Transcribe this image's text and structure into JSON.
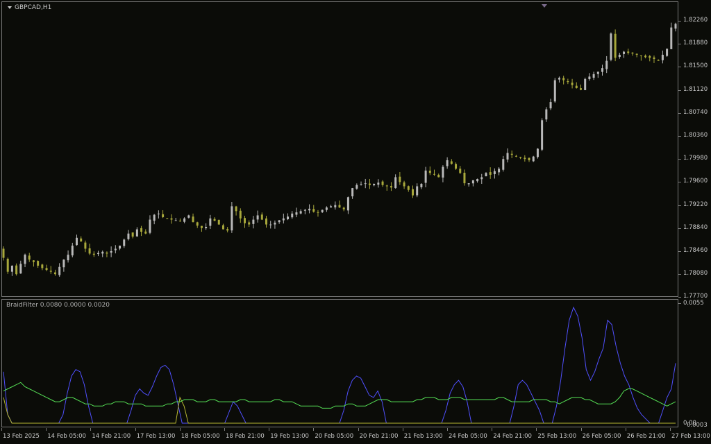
{
  "chart": {
    "title": "GBPCAD,H1",
    "indicator_title": "BraidFilter 0.0080 0.0000 0.0020",
    "colors": {
      "background": "#0b0c08",
      "bull": "#b9b9b9",
      "bear": "#a8a83c",
      "line_blue": "#5050ff",
      "line_yellow": "#b8b832",
      "line_green": "#56e256"
    }
  },
  "price_axis": {
    "labels": [
      "1.82260",
      "1.81880",
      "1.81500",
      "1.81120",
      "1.80740",
      "1.80360",
      "1.79980",
      "1.79600",
      "1.79220",
      "1.78840",
      "1.78460",
      "1.78080",
      "1.77700"
    ]
  },
  "indicator_axis": {
    "top_label": "0.0055",
    "bottom_labels": [
      "0.00",
      "0.0003"
    ]
  },
  "time_axis": {
    "labels": [
      "13 Feb 2025",
      "14 Feb 05:00",
      "14 Feb 21:00",
      "17 Feb 13:00",
      "18 Feb 05:00",
      "18 Feb 21:00",
      "19 Feb 13:00",
      "20 Feb 05:00",
      "20 Feb 21:00",
      "21 Feb 13:00",
      "24 Feb 05:00",
      "24 Feb 21:00",
      "25 Feb 13:00",
      "26 Feb 05:00",
      "26 Feb 21:00",
      "27 Feb 13:00"
    ]
  },
  "chart_data": {
    "type": "candlestick",
    "symbol": "GBPCAD",
    "timeframe": "H1",
    "ylim": [
      1.777,
      1.8245
    ],
    "closes": [
      1.7835,
      1.7812,
      1.7822,
      1.7808,
      1.7825,
      1.784,
      1.7832,
      1.7828,
      1.7822,
      1.7818,
      1.7815,
      1.7812,
      1.7808,
      1.782,
      1.7832,
      1.784,
      1.7855,
      1.7868,
      1.7862,
      1.785,
      1.7842,
      1.784,
      1.7843,
      1.7845,
      1.7842,
      1.7846,
      1.785,
      1.7855,
      1.7865,
      1.7875,
      1.787,
      1.7882,
      1.7878,
      1.7875,
      1.7898,
      1.7906,
      1.7908,
      1.7902,
      1.79,
      1.7898,
      1.7897,
      1.7895,
      1.79,
      1.7905,
      1.7894,
      1.7888,
      1.7884,
      1.7886,
      1.79,
      1.7896,
      1.789,
      1.7882,
      1.788,
      1.792,
      1.7912,
      1.79,
      1.7892,
      1.789,
      1.7898,
      1.7905,
      1.7898,
      1.789,
      1.789,
      1.7893,
      1.7897,
      1.79,
      1.7903,
      1.7908,
      1.791,
      1.7912,
      1.7914,
      1.7916,
      1.7911,
      1.791,
      1.7914,
      1.7918,
      1.792,
      1.7922,
      1.7918,
      1.7915,
      1.7935,
      1.795,
      1.7955,
      1.7957,
      1.7958,
      1.7955,
      1.7957,
      1.7959,
      1.7955,
      1.7953,
      1.7951,
      1.7968,
      1.796,
      1.7953,
      1.7947,
      1.7938,
      1.7953,
      1.7957,
      1.7979,
      1.7975,
      1.7973,
      1.7968,
      1.7985,
      1.7996,
      1.799,
      1.7982,
      1.7975,
      1.7958,
      1.7958,
      1.7963,
      1.7965,
      1.7968,
      1.7975,
      1.7972,
      1.7978,
      1.7982,
      1.7998,
      1.8008,
      1.8005,
      1.8002,
      1.8,
      1.7998,
      1.7996,
      1.8002,
      1.8015,
      1.8062,
      1.808,
      1.8092,
      1.8128,
      1.8132,
      1.8128,
      1.8125,
      1.812,
      1.8115,
      1.8112,
      1.813,
      1.8134,
      1.8138,
      1.8142,
      1.8148,
      1.816,
      1.8205,
      1.8165,
      1.817,
      1.8175,
      1.8173,
      1.8172,
      1.817,
      1.8168,
      1.8166,
      1.8165,
      1.8163,
      1.816,
      1.817,
      1.818,
      1.8215,
      1.8221
    ]
  },
  "indicator_data": {
    "type": "line",
    "ylim": [
      0,
      0.0055
    ],
    "series": [
      {
        "color": "#5050ff",
        "values": [
          0.0024,
          0.0004,
          0.0,
          0.0,
          0.0,
          0.0,
          0.0,
          0.0,
          0.0,
          0.0,
          0.0,
          0.0,
          0.0,
          0.0,
          0.0004,
          0.0014,
          0.0022,
          0.0025,
          0.0024,
          0.0018,
          0.0008,
          0.0,
          0.0,
          0.0,
          0.0,
          0.0,
          0.0,
          0.0,
          0.0,
          0.0,
          0.0006,
          0.0013,
          0.0016,
          0.0014,
          0.0013,
          0.0017,
          0.0022,
          0.0026,
          0.0027,
          0.0025,
          0.0018,
          0.0009,
          0.0,
          0.0,
          0.0,
          0.0,
          0.0,
          0.0,
          0.0,
          0.0,
          0.0,
          0.0,
          0.0,
          0.0005,
          0.001,
          0.0008,
          0.0004,
          0.0,
          0.0,
          0.0,
          0.0,
          0.0,
          0.0,
          0.0,
          0.0,
          0.0,
          0.0,
          0.0,
          0.0,
          0.0,
          0.0,
          0.0,
          0.0,
          0.0,
          0.0,
          0.0,
          0.0,
          0.0,
          0.0,
          0.0,
          0.0006,
          0.0015,
          0.002,
          0.0022,
          0.0021,
          0.0017,
          0.0013,
          0.0012,
          0.0015,
          0.001,
          0.0,
          0.0,
          0.0,
          0.0,
          0.0,
          0.0,
          0.0,
          0.0,
          0.0,
          0.0,
          0.0,
          0.0,
          0.0,
          0.0,
          0.0006,
          0.0014,
          0.0018,
          0.002,
          0.0017,
          0.001,
          0.0,
          0.0,
          0.0,
          0.0,
          0.0,
          0.0,
          0.0,
          0.0,
          0.0,
          0.0,
          0.0008,
          0.0018,
          0.002,
          0.0018,
          0.0014,
          0.001,
          0.0006,
          0.0,
          0.0,
          0.0,
          0.0008,
          0.002,
          0.0035,
          0.0048,
          0.0054,
          0.005,
          0.004,
          0.0025,
          0.002,
          0.0024,
          0.003,
          0.0035,
          0.0048,
          0.0046,
          0.0036,
          0.0028,
          0.0022,
          0.0018,
          0.0012,
          0.0007,
          0.0004,
          0.0002,
          0.0,
          0.0,
          0.0,
          0.0006,
          0.0012,
          0.0016,
          0.0028
        ]
      },
      {
        "color": "#b8b832",
        "values": [
          0.0012,
          0.0004,
          0.0,
          0.0,
          0.0,
          0.0,
          0.0,
          0.0,
          0.0,
          0.0,
          0.0,
          0.0,
          0.0,
          0.0,
          0.0,
          0.0,
          0.0,
          0.0,
          0.0,
          0.0,
          0.0,
          0.0,
          0.0,
          0.0,
          0.0,
          0.0,
          0.0,
          0.0,
          0.0,
          0.0,
          0.0,
          0.0,
          0.0,
          0.0,
          0.0,
          0.0,
          0.0,
          0.0,
          0.0,
          0.0,
          0.0,
          0.0,
          0.0012,
          0.0008,
          0.0,
          0.0,
          0.0,
          0.0,
          0.0,
          0.0,
          0.0,
          0.0,
          0.0,
          0.0,
          0.0,
          0.0,
          0.0,
          0.0,
          0.0,
          0.0,
          0.0,
          0.0,
          0.0,
          0.0,
          0.0,
          0.0,
          0.0,
          0.0,
          0.0,
          0.0,
          0.0,
          0.0,
          0.0,
          0.0,
          0.0,
          0.0,
          0.0,
          0.0,
          0.0,
          0.0,
          0.0,
          0.0,
          0.0,
          0.0,
          0.0,
          0.0,
          0.0,
          0.0,
          0.0,
          0.0,
          0.0,
          0.0,
          0.0,
          0.0,
          0.0,
          0.0,
          0.0,
          0.0,
          0.0,
          0.0,
          0.0,
          0.0,
          0.0,
          0.0,
          0.0,
          0.0,
          0.0,
          0.0,
          0.0,
          0.0,
          0.0,
          0.0,
          0.0,
          0.0,
          0.0,
          0.0,
          0.0,
          0.0,
          0.0,
          0.0,
          0.0,
          0.0,
          0.0,
          0.0,
          0.0,
          0.0,
          0.0,
          0.0,
          0.0,
          0.0,
          0.0,
          0.0,
          0.0,
          0.0,
          0.0,
          0.0,
          0.0,
          0.0,
          0.0,
          0.0,
          0.0,
          0.0,
          0.0,
          0.0,
          0.0,
          0.0,
          0.0,
          0.0,
          0.0,
          0.0,
          0.0,
          0.0,
          0.0,
          0.0,
          0.0,
          0.0,
          0.0,
          0.0,
          0.0,
          0.0,
          0.0
        ]
      },
      {
        "color": "#56e256",
        "values": [
          0.0015,
          0.0016,
          0.0017,
          0.0018,
          0.0019,
          0.0017,
          0.0016,
          0.0015,
          0.0014,
          0.0013,
          0.0012,
          0.0011,
          0.001,
          0.001,
          0.0011,
          0.0012,
          0.0012,
          0.0011,
          0.001,
          0.0009,
          0.0009,
          0.0008,
          0.0008,
          0.0008,
          0.0009,
          0.0009,
          0.001,
          0.001,
          0.001,
          0.0009,
          0.0009,
          0.0009,
          0.0009,
          0.0008,
          0.0008,
          0.0008,
          0.0008,
          0.0008,
          0.0009,
          0.0009,
          0.001,
          0.001,
          0.0011,
          0.0011,
          0.0011,
          0.001,
          0.001,
          0.001,
          0.0011,
          0.0011,
          0.001,
          0.001,
          0.001,
          0.001,
          0.001,
          0.0011,
          0.0011,
          0.001,
          0.001,
          0.001,
          0.001,
          0.001,
          0.001,
          0.0011,
          0.0011,
          0.001,
          0.001,
          0.001,
          0.0009,
          0.0008,
          0.0008,
          0.0008,
          0.0008,
          0.0008,
          0.0007,
          0.0007,
          0.0007,
          0.0008,
          0.0008,
          0.0008,
          0.0009,
          0.0009,
          0.0008,
          0.0008,
          0.0008,
          0.0009,
          0.001,
          0.0011,
          0.0011,
          0.0011,
          0.001,
          0.001,
          0.001,
          0.001,
          0.001,
          0.001,
          0.0011,
          0.0011,
          0.0012,
          0.0012,
          0.0012,
          0.0011,
          0.0011,
          0.0011,
          0.0012,
          0.0012,
          0.0012,
          0.0011,
          0.0011,
          0.0011,
          0.0011,
          0.0011,
          0.0011,
          0.0011,
          0.0011,
          0.0012,
          0.0012,
          0.0011,
          0.001,
          0.001,
          0.001,
          0.001,
          0.001,
          0.0011,
          0.0011,
          0.0011,
          0.0011,
          0.001,
          0.001,
          0.0009,
          0.001,
          0.0011,
          0.0012,
          0.0012,
          0.0012,
          0.0011,
          0.0011,
          0.001,
          0.0009,
          0.0009,
          0.0009,
          0.0009,
          0.001,
          0.0012,
          0.0015,
          0.0016,
          0.0016,
          0.0015,
          0.0014,
          0.0013,
          0.0012,
          0.0011,
          0.001,
          0.0009,
          0.0008,
          0.0009,
          0.001
        ]
      }
    ]
  }
}
